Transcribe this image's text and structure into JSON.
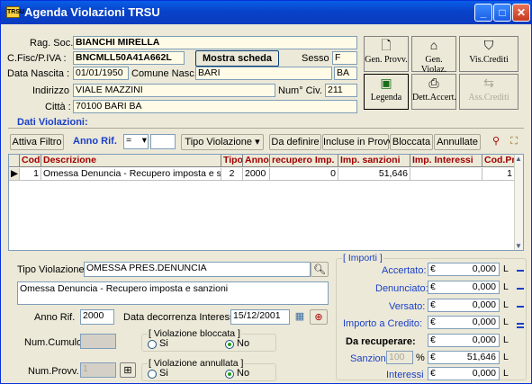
{
  "window": {
    "title": "Agenda Violazioni TRSU",
    "app_icon": "TRSU"
  },
  "header": {
    "rag_soc_label": "Rag. Soc. :",
    "rag_soc": "BIANCHI MIRELLA",
    "cf_label": "C.Fisc/P.IVA :",
    "cf": "BNCMLL50A41A662L",
    "mostra_scheda": "Mostra scheda",
    "sesso_label": "Sesso :",
    "sesso": "F",
    "data_nascita_label": "Data Nascita :",
    "data_nascita": "01/01/1950",
    "comune_label": "Comune Nasc. :",
    "comune": "BARI",
    "prov": "BA",
    "indirizzo_label": "Indirizzo :",
    "indirizzo": "VIALE MAZZINI",
    "civ_label": "Num° Civ. :",
    "civ": "211",
    "citta_label": "Città :",
    "citta": "70100 BARI BA"
  },
  "toolbar": {
    "gen_provv": "Gen. Provv.",
    "gen_violaz": "Gen. Violaz.",
    "vis_crediti": "Vis.Crediti",
    "legenda": "Legenda",
    "dett_accert": "Dett.Accert.",
    "ass_crediti": "Ass.Crediti"
  },
  "section_title": "Dati Violazioni:",
  "filter": {
    "attiva_filtro": "Attiva Filtro",
    "anno_rif": "Anno Rif.",
    "anno_op": "=",
    "tipo_violazione": "Tipo Violazione",
    "tabs": [
      "Da definire",
      "Incluse in Provv.",
      "Bloccata",
      "Annullate"
    ]
  },
  "grid": {
    "columns": [
      "Cod",
      "Descrizione",
      "Tipo",
      "Anno",
      "recupero Imp.",
      "Imp. sanzioni",
      "Imp. Interessi",
      "Cod.Pr."
    ],
    "rows": [
      {
        "cod": "1",
        "descrizione": "Omessa Denuncia - Recupero imposta e s",
        "tipo": "2",
        "anno": "2000",
        "recupero": "0",
        "sanzioni": "51,646",
        "interessi": "",
        "codpr": "1"
      }
    ]
  },
  "detail": {
    "tipo_violazione_label": "Tipo Violazione",
    "tipo_violazione": "OMESSA PRES.DENUNCIA",
    "descrizione": "Omessa Denuncia - Recupero imposta e sanzioni",
    "anno_rif_label": "Anno Rif.",
    "anno_rif": "2000",
    "data_decorrenza_label": "Data decorrenza Interessi",
    "data_decorrenza": "15/12/2001",
    "num_cumulo_label": "Num.Cumulo",
    "num_provv_label": "Num.Provv.",
    "num_provv": "1",
    "bloccata_caption": "[ Violazione bloccata ]",
    "annullata_caption": "[ Violazione annullata ]",
    "si": "Si",
    "no": "No"
  },
  "importi": {
    "caption": "[ Importi ]",
    "accertato_label": "Accertato:",
    "accertato": "0,000",
    "denunciato_label": "Denunciato:",
    "denunciato": "0,000",
    "versato_label": "Versato:",
    "versato": "0,000",
    "importo_credito_label": "Importo a Credito:",
    "importo_credito": "0,000",
    "da_recuperare_label": "Da recuperare:",
    "da_recuperare": "0,000",
    "sanzioni_label": "Sanzioni",
    "sanzioni_pct": "100",
    "sanzioni": "51,646",
    "interessi_label": "Interessi",
    "interessi": "0,000",
    "euro": "€",
    "currency": "L",
    "pct": "%"
  }
}
